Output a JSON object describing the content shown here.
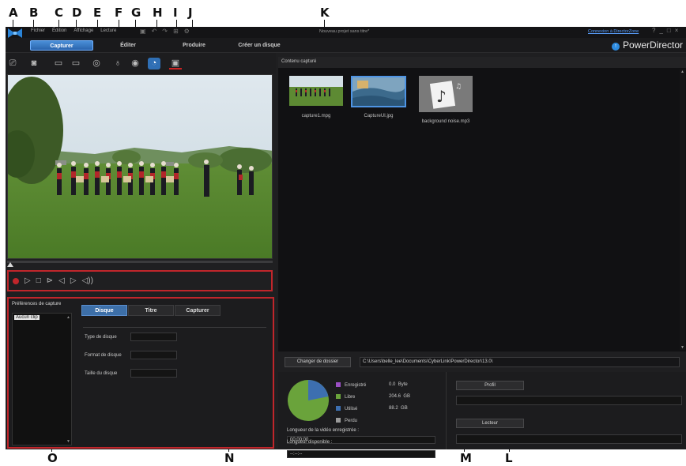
{
  "callouts": [
    "A",
    "B",
    "C",
    "D",
    "E",
    "F",
    "G",
    "H",
    "I",
    "J",
    "K",
    "L",
    "M",
    "N",
    "O"
  ],
  "titlebar": {
    "menu": [
      "Fichier",
      "Édition",
      "Affichage",
      "Lecture"
    ],
    "project_title": "Nouveau projet sans titre*",
    "directorzone_link": "Connexion à DirectorZone",
    "window_buttons": [
      "?",
      "_",
      "□",
      "×"
    ]
  },
  "modes": {
    "tabs": [
      "Capturer",
      "Éditer",
      "Produire",
      "Créer un disque"
    ],
    "active": "Capturer",
    "brand": "PowerDirector"
  },
  "capture_toolbar": {
    "tools": [
      "capture-from-dv-camcorder-icon",
      "capture-from-hdv-camcorder-icon",
      "capture-from-tv-icon",
      "capture-from-digital-tv-icon",
      "capture-from-webcam-icon",
      "capture-from-microphone-icon",
      "capture-from-cd-icon",
      "capture-from-dvd-icon",
      "capture-from-mobile-device-icon"
    ],
    "selected_tool": "capture-from-dvd-icon"
  },
  "playback": {
    "buttons": [
      "record-icon",
      "play-icon",
      "stop-icon",
      "fast-forward-icon",
      "previous-frame-icon",
      "next-frame-icon",
      "volume-icon"
    ]
  },
  "preferences": {
    "title": "Préférences de capture",
    "clip_list_item": "Aucun clip",
    "tabs": [
      "Disque",
      "Titre",
      "Capturer"
    ],
    "active_tab": "Disque",
    "fields": [
      {
        "label": "Type de disque",
        "value": ""
      },
      {
        "label": "Format de disque",
        "value": ""
      },
      {
        "label": "Taille du disque",
        "value": ""
      }
    ]
  },
  "captured_content": {
    "title": "Contenu capturé",
    "items": [
      {
        "name": "capture1.mpg",
        "kind": "video"
      },
      {
        "name": "CaptureUI.jpg",
        "kind": "image",
        "selected": true
      },
      {
        "name": "background noise.mp3",
        "kind": "audio"
      }
    ]
  },
  "folder": {
    "button_label": "Changer de dossier",
    "path": "C:\\Users\\belle_lee\\Documents\\CyberLink\\PowerDirector\\13.0\\"
  },
  "disk_usage": {
    "colors": {
      "enregistre": "#9b4fc4",
      "libre": "#6aa33b",
      "utilise": "#3d6fb0",
      "perdu": "#9a9a9a"
    },
    "legend": [
      {
        "label": "Enregistré",
        "value": "0.0",
        "unit": "Byte"
      },
      {
        "label": "Libre",
        "value": "204.6",
        "unit": "GB"
      },
      {
        "label": "Utilisé",
        "value": "88.2",
        "unit": "GB"
      },
      {
        "label": "Perdu",
        "value": "",
        "unit": ""
      }
    ],
    "recorded_length_label": "Longueur de la vidéo enregistrée :",
    "recorded_length": "00:00:00",
    "available_length_label": "Longueur disponible :",
    "available_length": "--:--:--"
  },
  "device": {
    "profile_button": "Profil",
    "player_button": "Lecteur"
  }
}
